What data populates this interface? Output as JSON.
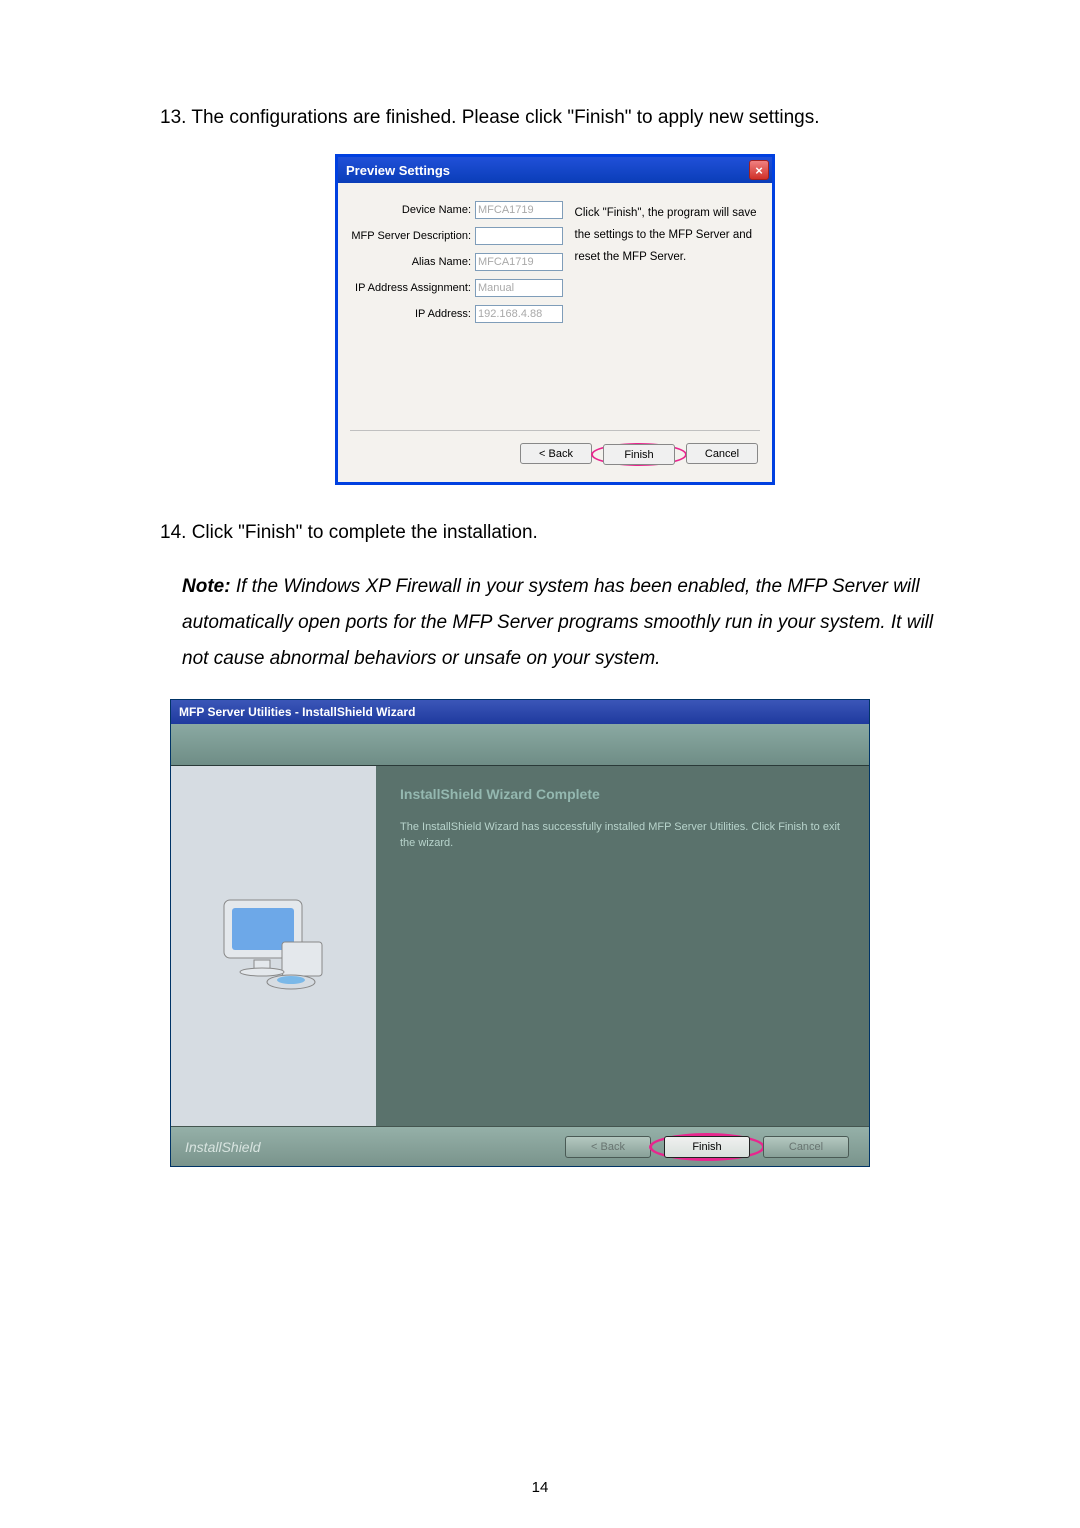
{
  "step13": {
    "number": "13.",
    "text": "The configurations are finished. Please click \"Finish\" to apply new settings."
  },
  "dialog1": {
    "title": "Preview Settings",
    "close": "×",
    "fields": {
      "device_name_label": "Device Name:",
      "device_name_value": "MFCA1719",
      "desc_label": "MFP Server Description:",
      "desc_value": "",
      "alias_label": "Alias Name:",
      "alias_value": "MFCA1719",
      "ip_assign_label": "IP Address Assignment:",
      "ip_assign_value": "Manual",
      "ip_addr_label": "IP Address:",
      "ip_addr_value": "192.168.4.88"
    },
    "hint": "Click \"Finish\", the program will save the settings to the MFP Server and reset the MFP Server.",
    "buttons": {
      "back": "< Back",
      "finish": "Finish",
      "cancel": "Cancel"
    }
  },
  "step14": {
    "number": "14.",
    "text": "Click \"Finish\" to complete the installation."
  },
  "note": {
    "label": "Note:",
    "body": " If the Windows XP Firewall in your system has been enabled, the MFP Server will automatically open ports for the MFP Server programs smoothly run in your system. It will not cause abnormal behaviors or unsafe on your system."
  },
  "dialog2": {
    "title": "MFP Server Utilities - InstallShield Wizard",
    "heading": "InstallShield Wizard Complete",
    "desc": "The InstallShield Wizard has successfully installed MFP Server Utilities.  Click Finish to exit the wizard.",
    "brand": "InstallShield",
    "buttons": {
      "back": "< Back",
      "finish": "Finish",
      "cancel": "Cancel"
    }
  },
  "page_number": "14"
}
